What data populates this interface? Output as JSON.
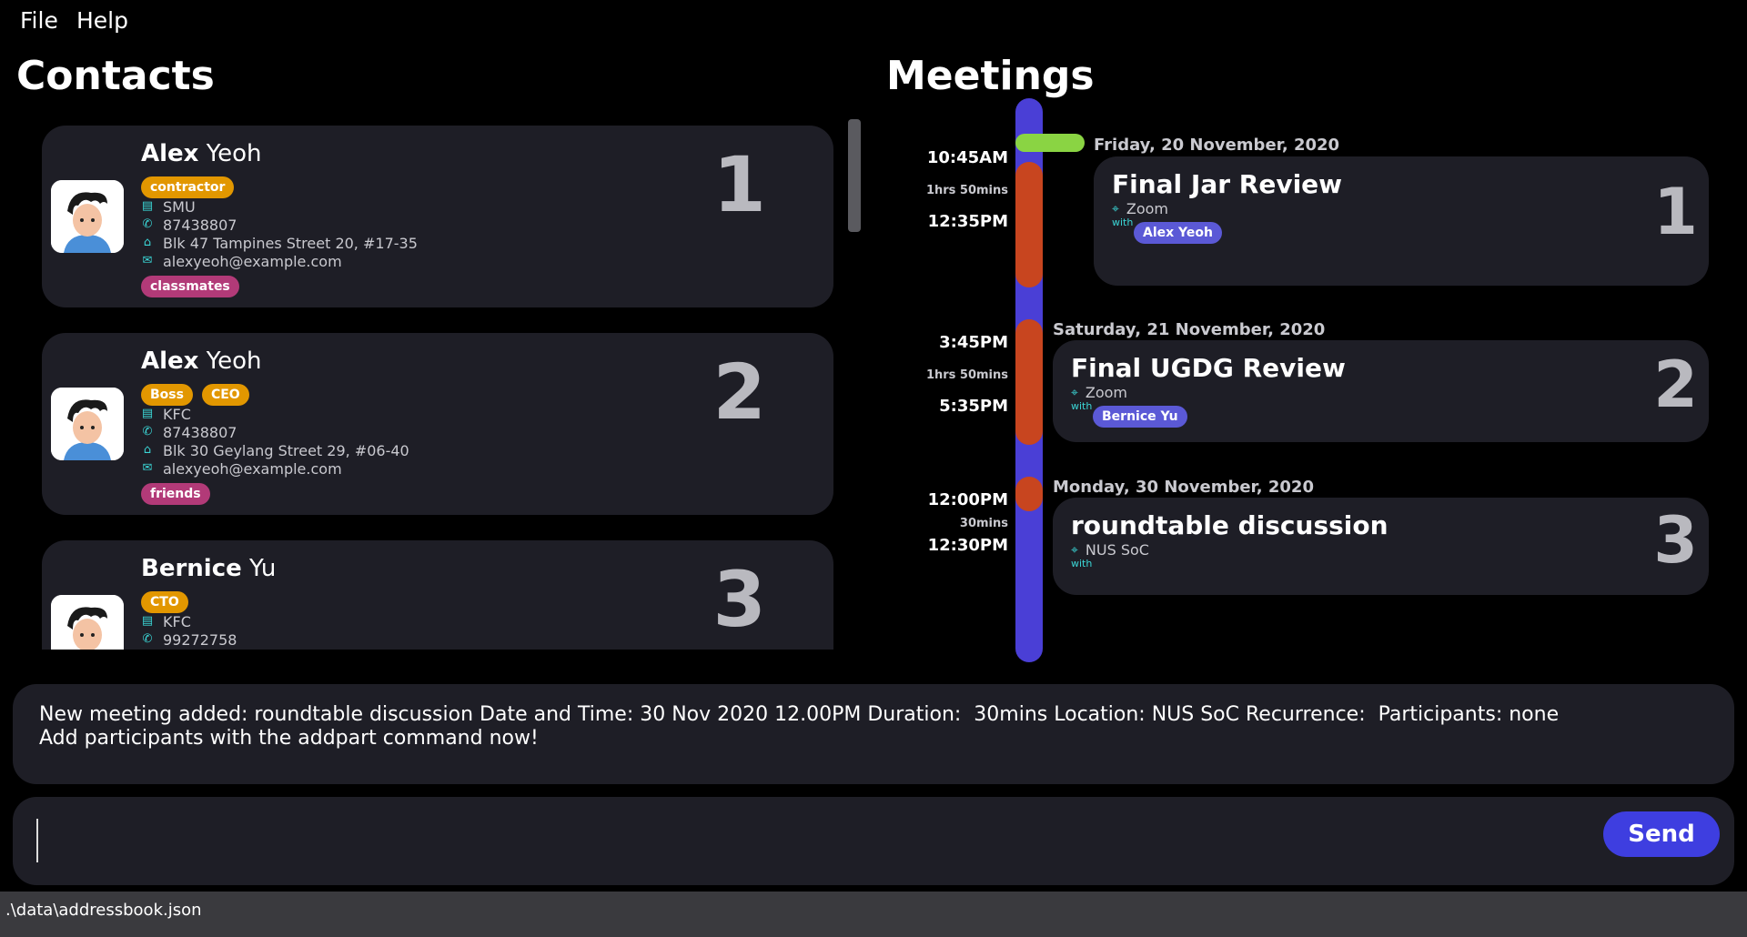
{
  "menu": {
    "file": "File",
    "help": "Help"
  },
  "contacts": {
    "title": "Contacts",
    "items": [
      {
        "first": "Alex",
        "last": " Yeoh",
        "index": "1",
        "tags": [
          "contractor"
        ],
        "company": "SMU",
        "phone": "87438807",
        "address": "Blk 47 Tampines Street 20, #17-35",
        "email": "alexyeoh@example.com",
        "groups": [
          "classmates"
        ]
      },
      {
        "first": "Alex",
        "last": " Yeoh",
        "index": "2",
        "tags": [
          "Boss",
          "CEO"
        ],
        "company": "KFC",
        "phone": "87438807",
        "address": "Blk 30 Geylang Street 29, #06-40",
        "email": "alexyeoh@example.com",
        "groups": [
          "friends"
        ]
      },
      {
        "first": "Bernice",
        "last": " Yu",
        "index": "3",
        "tags": [
          "CTO"
        ],
        "company": "KFC",
        "phone": "99272758"
      }
    ]
  },
  "meetings": {
    "title": "Meetings",
    "times": [
      {
        "start": "10:45AM",
        "duration": "1hrs 50mins",
        "end": "12:35PM"
      },
      {
        "start": "3:45PM",
        "duration": "1hrs 50mins",
        "end": "5:35PM"
      },
      {
        "start": "12:00PM",
        "duration": "30mins",
        "end": "12:30PM"
      }
    ],
    "items": [
      {
        "date": "Friday, 20 November, 2020",
        "title": "Final Jar Review",
        "location": "Zoom",
        "with_label": "with",
        "participants": [
          "Alex Yeoh"
        ],
        "index": "1"
      },
      {
        "date": "Saturday, 21 November, 2020",
        "title": "Final UGDG Review",
        "location": "Zoom",
        "with_label": "with",
        "participants": [
          "Bernice Yu"
        ],
        "index": "2"
      },
      {
        "date": "Monday, 30 November, 2020",
        "title": "roundtable discussion",
        "location": "NUS SoC",
        "with_label": "with",
        "participants": [],
        "index": "3"
      }
    ]
  },
  "result": {
    "text": "New meeting added: roundtable discussion Date and Time: 30 Nov 2020 12.00PM Duration:  30mins Location: NUS SoC Recurrence:  Participants: none\nAdd participants with the addpart command now!"
  },
  "command": {
    "value": "",
    "send_label": "Send"
  },
  "status": {
    "path": ".\\data\\addressbook.json"
  },
  "colors": {
    "accent": "#3e3ee0",
    "tag_orange": "#e29700",
    "tag_pink": "#b23a78",
    "timeline": "#4a3fd6",
    "meeting_block": "#c8451f",
    "now_marker": "#8ad443",
    "icon_cyan": "#3bd6d6"
  }
}
